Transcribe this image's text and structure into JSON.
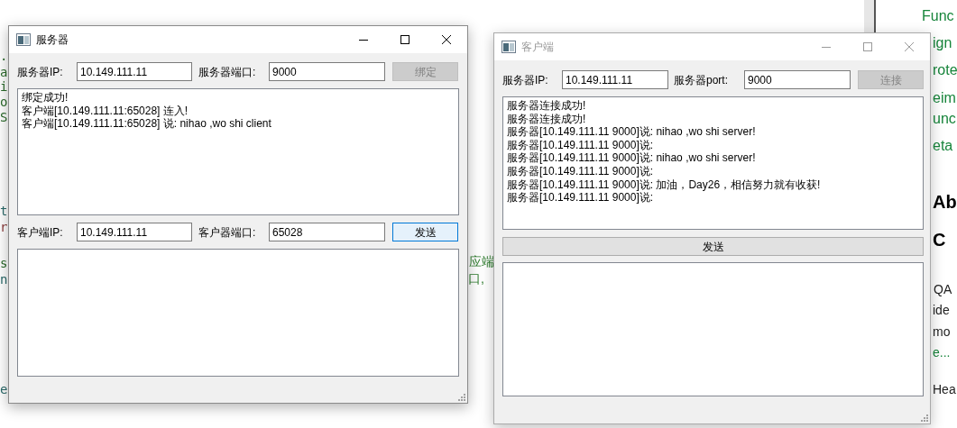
{
  "background": {
    "left_fragments": [
      ".",
      "a",
      "i",
      "o",
      "S",
      "t",
      "r",
      "s",
      "n",
      "e"
    ],
    "middle_fragments": [
      "应端",
      "口,"
    ],
    "right_links": [
      "Func",
      "ign",
      "rote",
      "eim",
      "unc",
      "eta"
    ],
    "right_heading": [
      "Ab",
      "C"
    ],
    "right_text": [
      {
        "text": "QA",
        "kind": "text"
      },
      {
        "text": "ide",
        "kind": "text"
      },
      {
        "text": "mo",
        "kind": "text"
      },
      {
        "text": "e...",
        "kind": "link"
      },
      {
        "text": "Hea",
        "kind": "text"
      }
    ]
  },
  "server_window": {
    "title": "服务器",
    "active": true,
    "server_ip": {
      "label": "服务器IP:",
      "value": "10.149.111.11"
    },
    "server_port": {
      "label": "服务器端口:",
      "value": "9000"
    },
    "bind_button": {
      "label": "绑定",
      "disabled": true
    },
    "log": [
      "绑定成功!",
      "客户端[10.149.111.11:65028] 连入!",
      "客户端[10.149.111.11:65028] 说: nihao ,wo shi client"
    ],
    "client_ip": {
      "label": "客户端IP:",
      "value": "10.149.111.11"
    },
    "client_port": {
      "label": "客户器端口:",
      "value": "65028"
    },
    "send_button": {
      "label": "发送",
      "focused": true
    }
  },
  "client_window": {
    "title": "客户端",
    "active": false,
    "server_ip": {
      "label": "服务器IP:",
      "value": "10.149.111.11"
    },
    "server_port": {
      "label": "服务器port:",
      "value": "9000"
    },
    "connect_button": {
      "label": "连接",
      "disabled": true
    },
    "log": [
      "服务器连接成功!",
      "服务器连接成功!",
      "服务器[10.149.111.11 9000]说: nihao ,wo shi server!",
      "服务器[10.149.111.11 9000]说:",
      "服务器[10.149.111.11 9000]说: nihao ,wo shi server!",
      "服务器[10.149.111.11 9000]说:",
      "服务器[10.149.111.11 9000]说: 加油，Day26，相信努力就有收获!",
      "服务器[10.149.111.11 9000]说:"
    ],
    "send_button": {
      "label": "发送",
      "focused": false
    }
  }
}
